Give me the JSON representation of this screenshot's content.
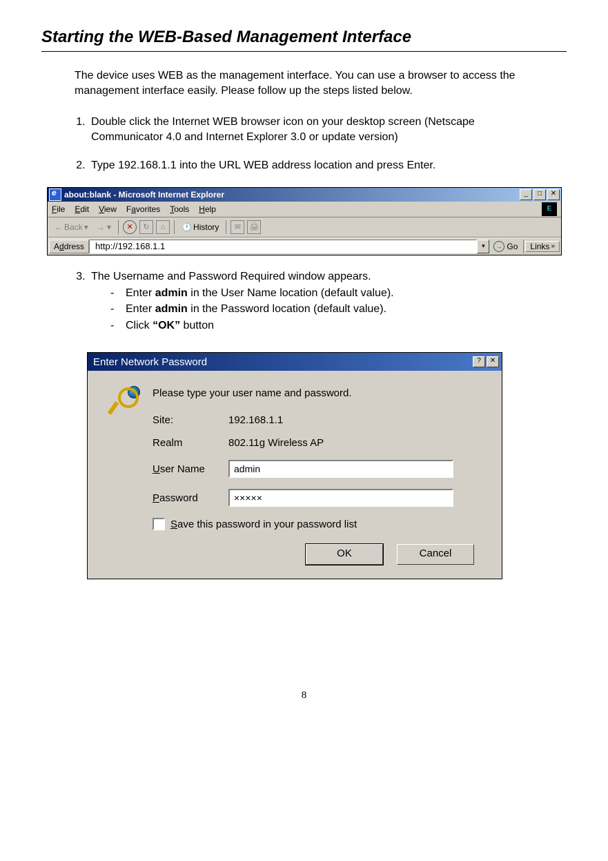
{
  "heading": "Starting the WEB-Based Management Interface",
  "intro": "The device uses WEB as the management interface. You can use a browser to access the management interface easily. Please follow up the steps listed below.",
  "steps": {
    "s1": "Double click the Internet WEB browser icon on your desktop screen (Netscape Communicator 4.0 and Internet Explorer 3.0 or update version)",
    "s2": "Type 192.168.1.1 into the URL WEB address location and press Enter.",
    "s3": "The Username and Password Required window appears.",
    "s3a_pre": "Enter ",
    "s3a_bold": "admin",
    "s3a_post": " in the User Name location (default value).",
    "s3b_pre": "Enter ",
    "s3b_bold": "admin",
    "s3b_post": " in the Password location (default value).",
    "s3c_pre": "Click ",
    "s3c_bold": "“OK”",
    "s3c_post": " button"
  },
  "ie": {
    "title": "about:blank - Microsoft Internet Explorer",
    "min": "_",
    "max": "□",
    "close": "✕",
    "menu_file": "File",
    "menu_edit": "Edit",
    "menu_view": "View",
    "menu_fav": "Favorites",
    "menu_tools": "Tools",
    "menu_help": "Help",
    "back": "Back",
    "history": "History",
    "addr_label": "Address",
    "addr_value": "http://192.168.1.1",
    "go": "Go",
    "links": "Links"
  },
  "dialog": {
    "title": "Enter Network Password",
    "help": "?",
    "close": "✕",
    "prompt": "Please type your user name and password.",
    "site_label": "Site:",
    "site_value": "192.168.1.1",
    "realm_label": "Realm",
    "realm_value": "802.11g Wireless AP",
    "user_label": "User Name",
    "user_value": "admin",
    "pass_label": "Password",
    "pass_value": "×××××",
    "save_label": "Save this password in your password list",
    "ok": "OK",
    "cancel": "Cancel"
  },
  "page_number": "8"
}
